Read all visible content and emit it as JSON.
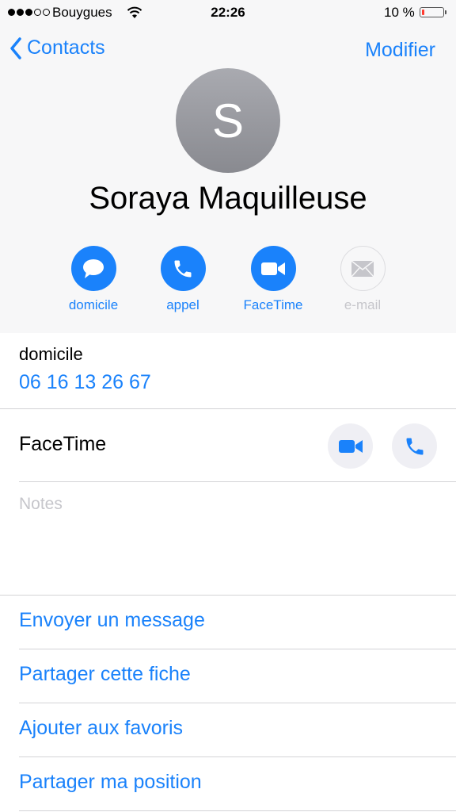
{
  "status_bar": {
    "carrier": "Bouygues",
    "time": "22:26",
    "battery_percent": "10 %",
    "battery_level": 0.1,
    "signal_bars_filled": 3,
    "signal_bars_total": 5
  },
  "nav": {
    "back_label": "Contacts",
    "edit_label": "Modifier"
  },
  "contact": {
    "initial": "S",
    "name": "Soraya Maquilleuse"
  },
  "actions": {
    "message_label": "domicile",
    "call_label": "appel",
    "facetime_label": "FaceTime",
    "email_label": "e-mail"
  },
  "phone": {
    "label": "domicile",
    "number": "06 16 13 26 67"
  },
  "facetime_row": {
    "label": "FaceTime"
  },
  "notes": {
    "placeholder": "Notes"
  },
  "links": {
    "send_message": "Envoyer un message",
    "share_contact": "Partager cette fiche",
    "add_favorites": "Ajouter aux favoris",
    "share_location": "Partager ma position"
  },
  "colors": {
    "accent": "#1a82fb",
    "header_bg": "#f7f7f8",
    "battery_low": "#ff3b30"
  }
}
